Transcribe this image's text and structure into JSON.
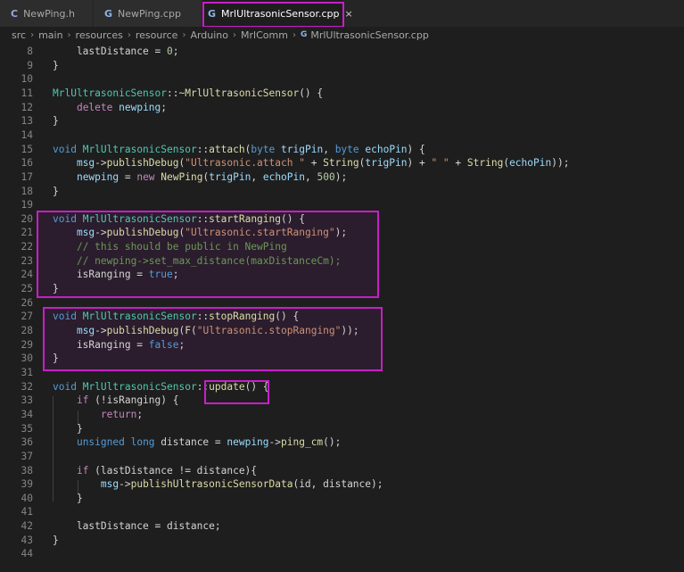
{
  "tabs": [
    {
      "icon": "C",
      "label": "NewPing.h"
    },
    {
      "icon": "G",
      "label": "NewPing.cpp"
    },
    {
      "icon": "G",
      "label": "MrlUltrasonicSensor.cpp",
      "close": "×"
    }
  ],
  "breadcrumb": [
    "src",
    "main",
    "resources",
    "resource",
    "Arduino",
    "MrlComm",
    "MrlUltrasonicSensor.cpp"
  ],
  "breadcrumb_file_icon": "G",
  "code_lines": [
    {
      "n": "8",
      "t": "    lastDistance = 0;"
    },
    {
      "n": "9",
      "t": "}"
    },
    {
      "n": "10",
      "t": ""
    },
    {
      "n": "11",
      "t": "MrlUltrasonicSensor::~MrlUltrasonicSensor() {"
    },
    {
      "n": "12",
      "t": "    delete newping;"
    },
    {
      "n": "13",
      "t": "}"
    },
    {
      "n": "14",
      "t": ""
    },
    {
      "n": "15",
      "t": "void MrlUltrasonicSensor::attach(byte trigPin, byte echoPin) {"
    },
    {
      "n": "16",
      "t": "    msg->publishDebug(\"Ultrasonic.attach \" + String(trigPin) + \" \" + String(echoPin));"
    },
    {
      "n": "17",
      "t": "    newping = new NewPing(trigPin, echoPin, 500);"
    },
    {
      "n": "18",
      "t": "}"
    },
    {
      "n": "19",
      "t": ""
    },
    {
      "n": "20",
      "t": "void MrlUltrasonicSensor::startRanging() {"
    },
    {
      "n": "21",
      "t": "    msg->publishDebug(\"Ultrasonic.startRanging\");"
    },
    {
      "n": "22",
      "t": "    // this should be public in NewPing"
    },
    {
      "n": "23",
      "t": "    // newping->set_max_distance(maxDistanceCm);"
    },
    {
      "n": "24",
      "t": "    isRanging = true;"
    },
    {
      "n": "25",
      "t": "}"
    },
    {
      "n": "26",
      "t": ""
    },
    {
      "n": "27",
      "t": "void MrlUltrasonicSensor::stopRanging() {"
    },
    {
      "n": "28",
      "t": "    msg->publishDebug(F(\"Ultrasonic.stopRanging\"));"
    },
    {
      "n": "29",
      "t": "    isRanging = false;"
    },
    {
      "n": "30",
      "t": "}"
    },
    {
      "n": "31",
      "t": ""
    },
    {
      "n": "32",
      "t": "void MrlUltrasonicSensor::update() {"
    },
    {
      "n": "33",
      "t": "    if (!isRanging) {"
    },
    {
      "n": "34",
      "t": "        return;"
    },
    {
      "n": "35",
      "t": "    }"
    },
    {
      "n": "36",
      "t": "    unsigned long distance = newping->ping_cm();"
    },
    {
      "n": "37",
      "t": ""
    },
    {
      "n": "38",
      "t": "    if (lastDistance != distance){"
    },
    {
      "n": "39",
      "t": "        msg->publishUltrasonicSensorData(id, distance);"
    },
    {
      "n": "40",
      "t": "    }"
    },
    {
      "n": "41",
      "t": ""
    },
    {
      "n": "42",
      "t": "    lastDistance = distance;"
    },
    {
      "n": "43",
      "t": "}"
    },
    {
      "n": "44",
      "t": ""
    }
  ],
  "colors": {
    "background": "#1e1e1e",
    "keyword": "#569cd6",
    "control": "#c586c0",
    "type": "#4ec9b0",
    "function": "#dcdcaa",
    "string": "#ce9178",
    "number": "#b5cea8",
    "comment": "#6a9955",
    "variable": "#9cdcfe",
    "annotation_box": "#c81ec8"
  }
}
